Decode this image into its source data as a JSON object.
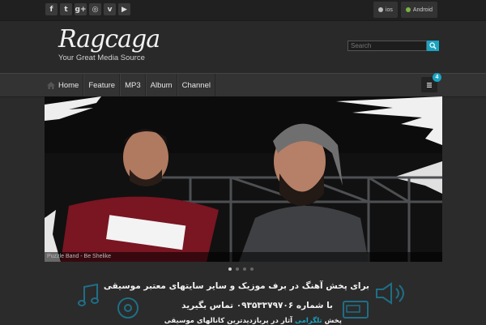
{
  "topbar": {
    "social": [
      {
        "icon": "facebook-icon",
        "glyph": "f"
      },
      {
        "icon": "twitter-icon",
        "glyph": "t"
      },
      {
        "icon": "google-plus-icon",
        "glyph": "g+"
      },
      {
        "icon": "instagram-icon",
        "glyph": "◎"
      },
      {
        "icon": "vimeo-icon",
        "glyph": "v"
      },
      {
        "icon": "youtube-icon",
        "glyph": "▶"
      }
    ],
    "apps": {
      "ios_label": "ios",
      "android_label": "Android"
    }
  },
  "header": {
    "logo_text": "Ragcaga",
    "tagline": "Your Great Media Source",
    "search_placeholder": "Search"
  },
  "nav": {
    "items": [
      "Home",
      "Feature",
      "MP3",
      "Album",
      "Channel"
    ],
    "badge_count": "4"
  },
  "slider": {
    "caption": "Puzzle Band - Be Shelike",
    "dots_total": 4,
    "active_index": 0
  },
  "promo": {
    "line1": "برای پخش آهنگ در برف موزیک و سایر سایتهای معتبر موسیقی",
    "line2": "با شماره ۰۹۳۵۳۳۷۹۷۰۶ تماس بگیرید",
    "line3_prefix": "پخش",
    "line3_highlight": "تلگرامی",
    "line3_suffix": "آثار در پربازدیدترین کانالهای موسیقی"
  },
  "colors": {
    "accent": "#1aa3c1",
    "android": "#7cb342"
  }
}
